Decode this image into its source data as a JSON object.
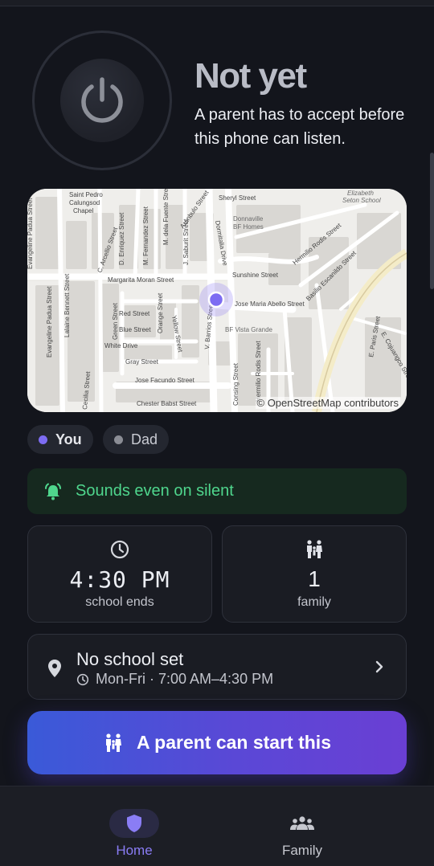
{
  "status": {
    "title": "Not yet",
    "subtitle": "A parent has to accept before this phone can listen."
  },
  "map": {
    "attribution": "© OpenStreetMap contributors",
    "labels": [
      "Saint Pedro Calungsod Chapel",
      "Evangeline Padua Street",
      "Lalaine Bennett Street",
      "C. Arcellio Street",
      "D. Enriquez Street",
      "M. Fernandez Street",
      "M. dela Fuente Street",
      "J. Saburit Street",
      "Aranbulo Street",
      "Sheryl Street",
      "Donnaville BF Homes",
      "Elizabeth Seton School",
      "Margarita Moran Street",
      "Sunshine Street",
      "Hermilio Rodis Street",
      "Basilio Escanildo Street",
      "Jose Maria Abello Street",
      "BF Vista Grande",
      "Red Street",
      "Blue Street",
      "Green Street",
      "Orange Street",
      "Yellow Street",
      "White Drive",
      "Gray Street",
      "V. Barrios Street",
      "Jose Facundo Street",
      "Chester Babst Street",
      "Cecilia Street",
      "Consing Street",
      "E. Cojuangco Street",
      "E. Paris Street",
      "Dormitalia Drive"
    ]
  },
  "members": [
    {
      "name": "You",
      "color": "#7d6cf2"
    },
    {
      "name": "Dad",
      "color": "#8b8d95"
    }
  ],
  "banner": {
    "text": "Sounds even on silent",
    "icon": "alarm-bell-icon",
    "color": "#4fd68d"
  },
  "cards": {
    "time": {
      "value": "4:30 PM",
      "label": "school ends",
      "icon": "clock-icon"
    },
    "family": {
      "value": "1",
      "label": "family",
      "icon": "family-icon"
    }
  },
  "school": {
    "title": "No school set",
    "schedule": "Mon-Fri · 7:00 AM–4:30 PM",
    "icon": "location-pin-icon"
  },
  "cta": {
    "label": "A parent can start this",
    "icon": "family-icon"
  },
  "nav": {
    "items": [
      {
        "label": "Home",
        "icon": "shield-icon",
        "active": true
      },
      {
        "label": "Family",
        "icon": "group-icon",
        "active": false
      }
    ]
  },
  "colors": {
    "accent": "#7d6cf2",
    "background": "#13151c",
    "success": "#4fd68d"
  }
}
